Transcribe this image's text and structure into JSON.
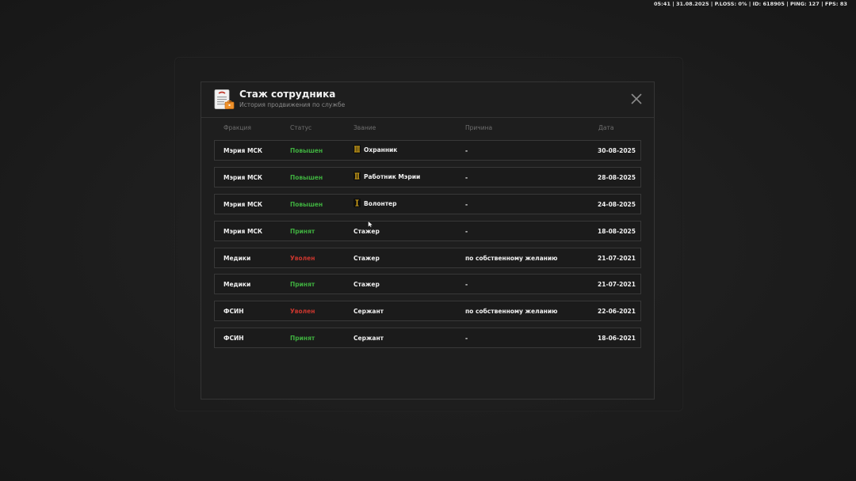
{
  "hud": {
    "text": "05:41 | 31.08.2025 | P.LOSS: 0% | ID: 618905 | PING: 127 | FPS: 83"
  },
  "modal": {
    "title": "Стаж сотрудника",
    "subtitle": "История продвижения по службе",
    "icon": "document-icon",
    "close_icon": "close-icon"
  },
  "columns": {
    "faction": "Фракция",
    "status": "Статус",
    "rank": "Звание",
    "reason": "Причина",
    "date": "Дата"
  },
  "colors": {
    "promoted": "#3fae3f",
    "fired": "#c9362e",
    "rank_icon": "#e6b219"
  },
  "rows": [
    {
      "faction": "Мэрия МСК",
      "status": "Повышен",
      "status_color": "green",
      "rank": "Охранник",
      "rank_icon": "rank-icon-3",
      "reason": "-",
      "date": "30-08-2025"
    },
    {
      "faction": "Мэрия МСК",
      "status": "Повышен",
      "status_color": "green",
      "rank": "Работник Мэрии",
      "rank_icon": "rank-icon-2",
      "reason": "-",
      "date": "28-08-2025"
    },
    {
      "faction": "Мэрия МСК",
      "status": "Повышен",
      "status_color": "green",
      "rank": "Волонтер",
      "rank_icon": "rank-icon-1",
      "reason": "-",
      "date": "24-08-2025"
    },
    {
      "faction": "Мэрия МСК",
      "status": "Принят",
      "status_color": "green",
      "rank": "Стажер",
      "rank_icon": "",
      "reason": "-",
      "date": "18-08-2025"
    },
    {
      "faction": "Медики",
      "status": "Уволен",
      "status_color": "red",
      "rank": "Стажер",
      "rank_icon": "",
      "reason": "по собственному желанию",
      "date": "21-07-2021"
    },
    {
      "faction": "Медики",
      "status": "Принят",
      "status_color": "green",
      "rank": "Стажер",
      "rank_icon": "",
      "reason": "-",
      "date": "21-07-2021"
    },
    {
      "faction": "ФСИН",
      "status": "Уволен",
      "status_color": "red",
      "rank": "Сержант",
      "rank_icon": "",
      "reason": "по собственному желанию",
      "date": "22-06-2021"
    },
    {
      "faction": "ФСИН",
      "status": "Принят",
      "status_color": "green",
      "rank": "Сержант",
      "rank_icon": "",
      "reason": "-",
      "date": "18-06-2021"
    }
  ]
}
